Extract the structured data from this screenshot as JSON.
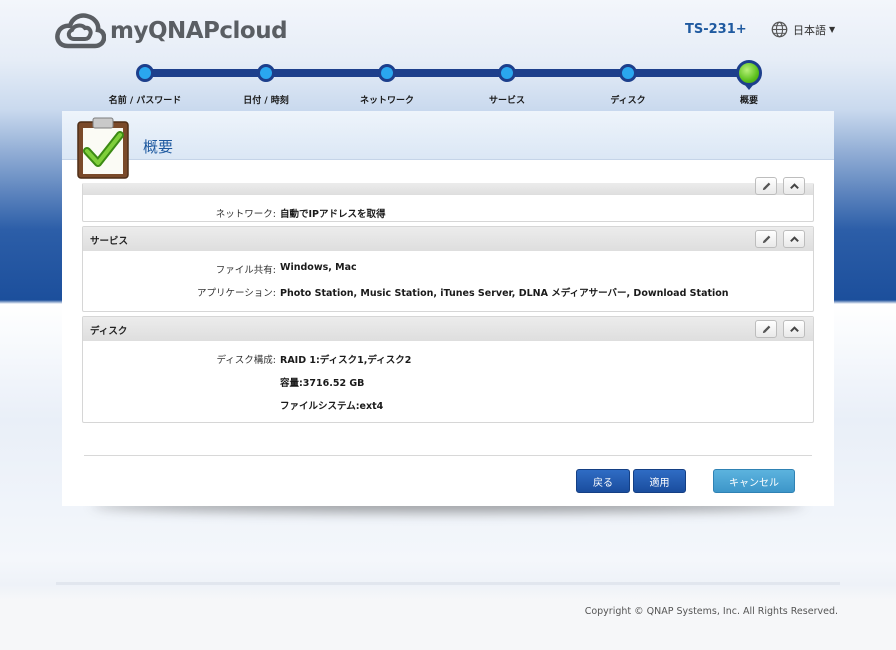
{
  "brand": {
    "name": "myQNAPcloud"
  },
  "header": {
    "model": "TS-231+",
    "language": "日本語"
  },
  "steps": [
    {
      "label": "名前 / パスワード",
      "active": false
    },
    {
      "label": "日付 / 時刻",
      "active": false
    },
    {
      "label": "ネットワーク",
      "active": false
    },
    {
      "label": "サービス",
      "active": false
    },
    {
      "label": "ディスク",
      "active": false
    },
    {
      "label": "概要",
      "active": true
    }
  ],
  "panel": {
    "title": "概要"
  },
  "sections": {
    "network": {
      "rows": [
        {
          "key": "ネットワーク:",
          "value": "自動でIPアドレスを取得"
        }
      ]
    },
    "services": {
      "title": "サービス",
      "rows": [
        {
          "key": "ファイル共有:",
          "value": "Windows, Mac"
        },
        {
          "key": "アプリケーション:",
          "value": "Photo Station, Music Station, iTunes Server, DLNA メディアサーバー, Download Station"
        }
      ]
    },
    "disk": {
      "title": "ディスク",
      "rows": [
        {
          "key": "ディスク構成:",
          "value": "RAID 1:ディスク1,ディスク2"
        },
        {
          "key": "",
          "value": "容量:3716.52 GB"
        },
        {
          "key": "",
          "value": "ファイルシステム:ext4"
        }
      ]
    }
  },
  "buttons": {
    "back": "戻る",
    "apply": "適用",
    "cancel": "キャンセル"
  },
  "footer": {
    "copyright": "Copyright © QNAP Systems, Inc. All Rights Reserved."
  }
}
